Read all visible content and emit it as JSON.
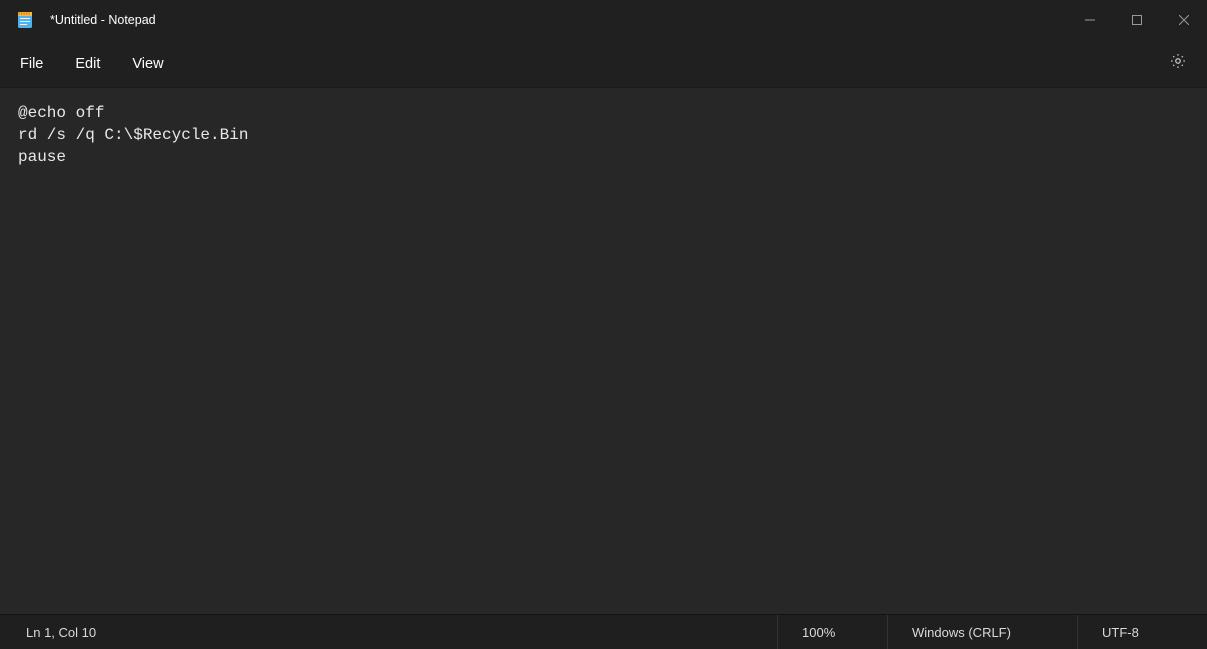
{
  "titlebar": {
    "title": "*Untitled - Notepad"
  },
  "menu": {
    "file": "File",
    "edit": "Edit",
    "view": "View"
  },
  "editor": {
    "content": "@echo off\nrd /s /q C:\\$Recycle.Bin\npause"
  },
  "statusbar": {
    "position": "Ln 1, Col 10",
    "zoom": "100%",
    "line_ending": "Windows (CRLF)",
    "encoding": "UTF-8"
  }
}
